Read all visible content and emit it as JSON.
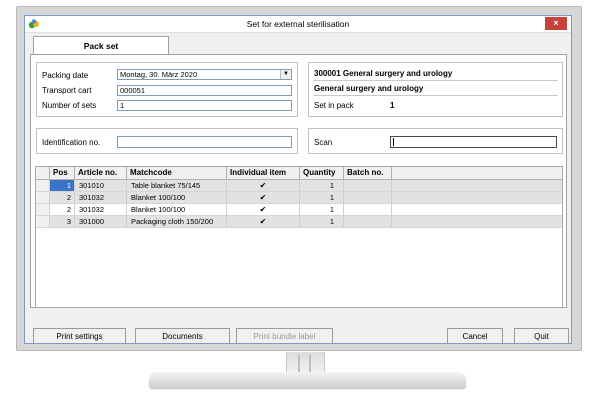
{
  "window": {
    "title": "Set for external sterilisation",
    "close_glyph": "×",
    "icon": "app-icon"
  },
  "tabs": [
    {
      "label": "Pack set"
    }
  ],
  "packing": {
    "date_label": "Packing date",
    "date_value": "Montag, 30. März 2020",
    "cart_label": "Transport cart",
    "cart_value": "000051",
    "sets_label": "Number of sets",
    "sets_value": "1"
  },
  "set_info": {
    "code_line": "300001   General surgery and urology",
    "name_line": "General surgery and urology",
    "set_in_pack_label": "Set in pack",
    "set_in_pack_value": "1"
  },
  "identification": {
    "label": "Identification no.",
    "value": ""
  },
  "scan": {
    "label": "Scan",
    "value": ""
  },
  "table": {
    "columns": [
      "Pos",
      "Article no.",
      "Matchcode",
      "Individual item",
      "Quantity",
      "Batch no."
    ],
    "rows": [
      {
        "pos": "1",
        "article": "301010",
        "matchcode": "Table blanket 75/145",
        "individual": "✔",
        "quantity": "1",
        "batch": ""
      },
      {
        "pos": "2",
        "article": "301032",
        "matchcode": "Blanket 100/100",
        "individual": "✔",
        "quantity": "1",
        "batch": ""
      },
      {
        "pos": "2",
        "article": "301032",
        "matchcode": "Blanket 100/100",
        "individual": "✔",
        "quantity": "1",
        "batch": ""
      },
      {
        "pos": "3",
        "article": "301000",
        "matchcode": "Packaging cloth 150/200",
        "individual": "✔",
        "quantity": "1",
        "batch": ""
      }
    ]
  },
  "buttons": {
    "print_settings": "Print settings",
    "documents": "Documents",
    "print_bundle_label": "Print bundle label",
    "cancel": "Cancel",
    "quit": "Quit"
  },
  "colors": {
    "selection": "#3b73c8",
    "close": "#c7403a",
    "alt_row": "#e2e2e2"
  }
}
